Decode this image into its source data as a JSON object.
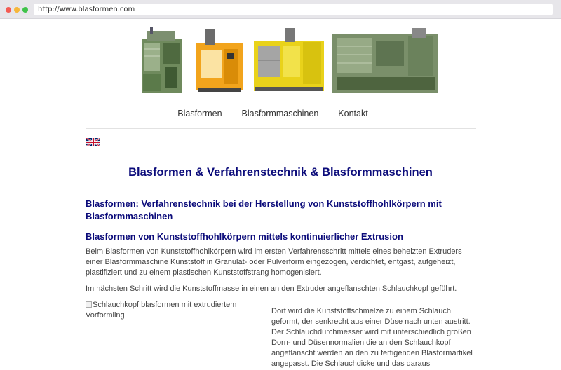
{
  "browser": {
    "url": "http://www.blasformen.com"
  },
  "nav": {
    "items": [
      "Blasformen",
      "Blasformmaschinen",
      "Kontakt"
    ]
  },
  "header": {
    "image_alt": "Blasformmaschinen"
  },
  "language": {
    "flag": "uk-flag-icon"
  },
  "main": {
    "title": "Blasformen & Verfahrenstechnik & Blasformmaschinen",
    "heading1": "Blasformen: Verfahrenstechnik bei der Herstellung von Kunststoffhohlkörpern mit Blasformmaschinen",
    "heading2": "Blasformen von Kunststoffhohlkörpern mittels kontinuierlicher Extrusion",
    "para1": "Beim Blasformen von Kunststoffhohlkörpern wird im ersten Verfahrensschritt mittels eines beheizten Extruders einer Blasformmaschine Kunststoff in Granulat- oder Pulverform eingezogen, verdichtet, entgast, aufgeheizt, plastifiziert und zu einem plastischen Kunststoffstrang homogenisiert.",
    "para2": "Im nächsten Schritt wird die Kunststoffmasse in einen an den Extruder angeflanschten Schlauchkopf geführt.",
    "image_alt": "Schlauchkopf blasformen mit extrudiertem Vorformling",
    "para3": "Dort wird die Kunststoffschmelze zu einem Schlauch geformt, der senkrecht aus einer Düse nach unten austritt. Der Schlauchdurchmesser wird mit unterschiedlich großen Dorn- und Düsennormalien die an den Schlauchkopf angeflanscht werden an den zu fertigenden Blasformartikel angepasst. Die Schlauchdicke und das daraus"
  }
}
